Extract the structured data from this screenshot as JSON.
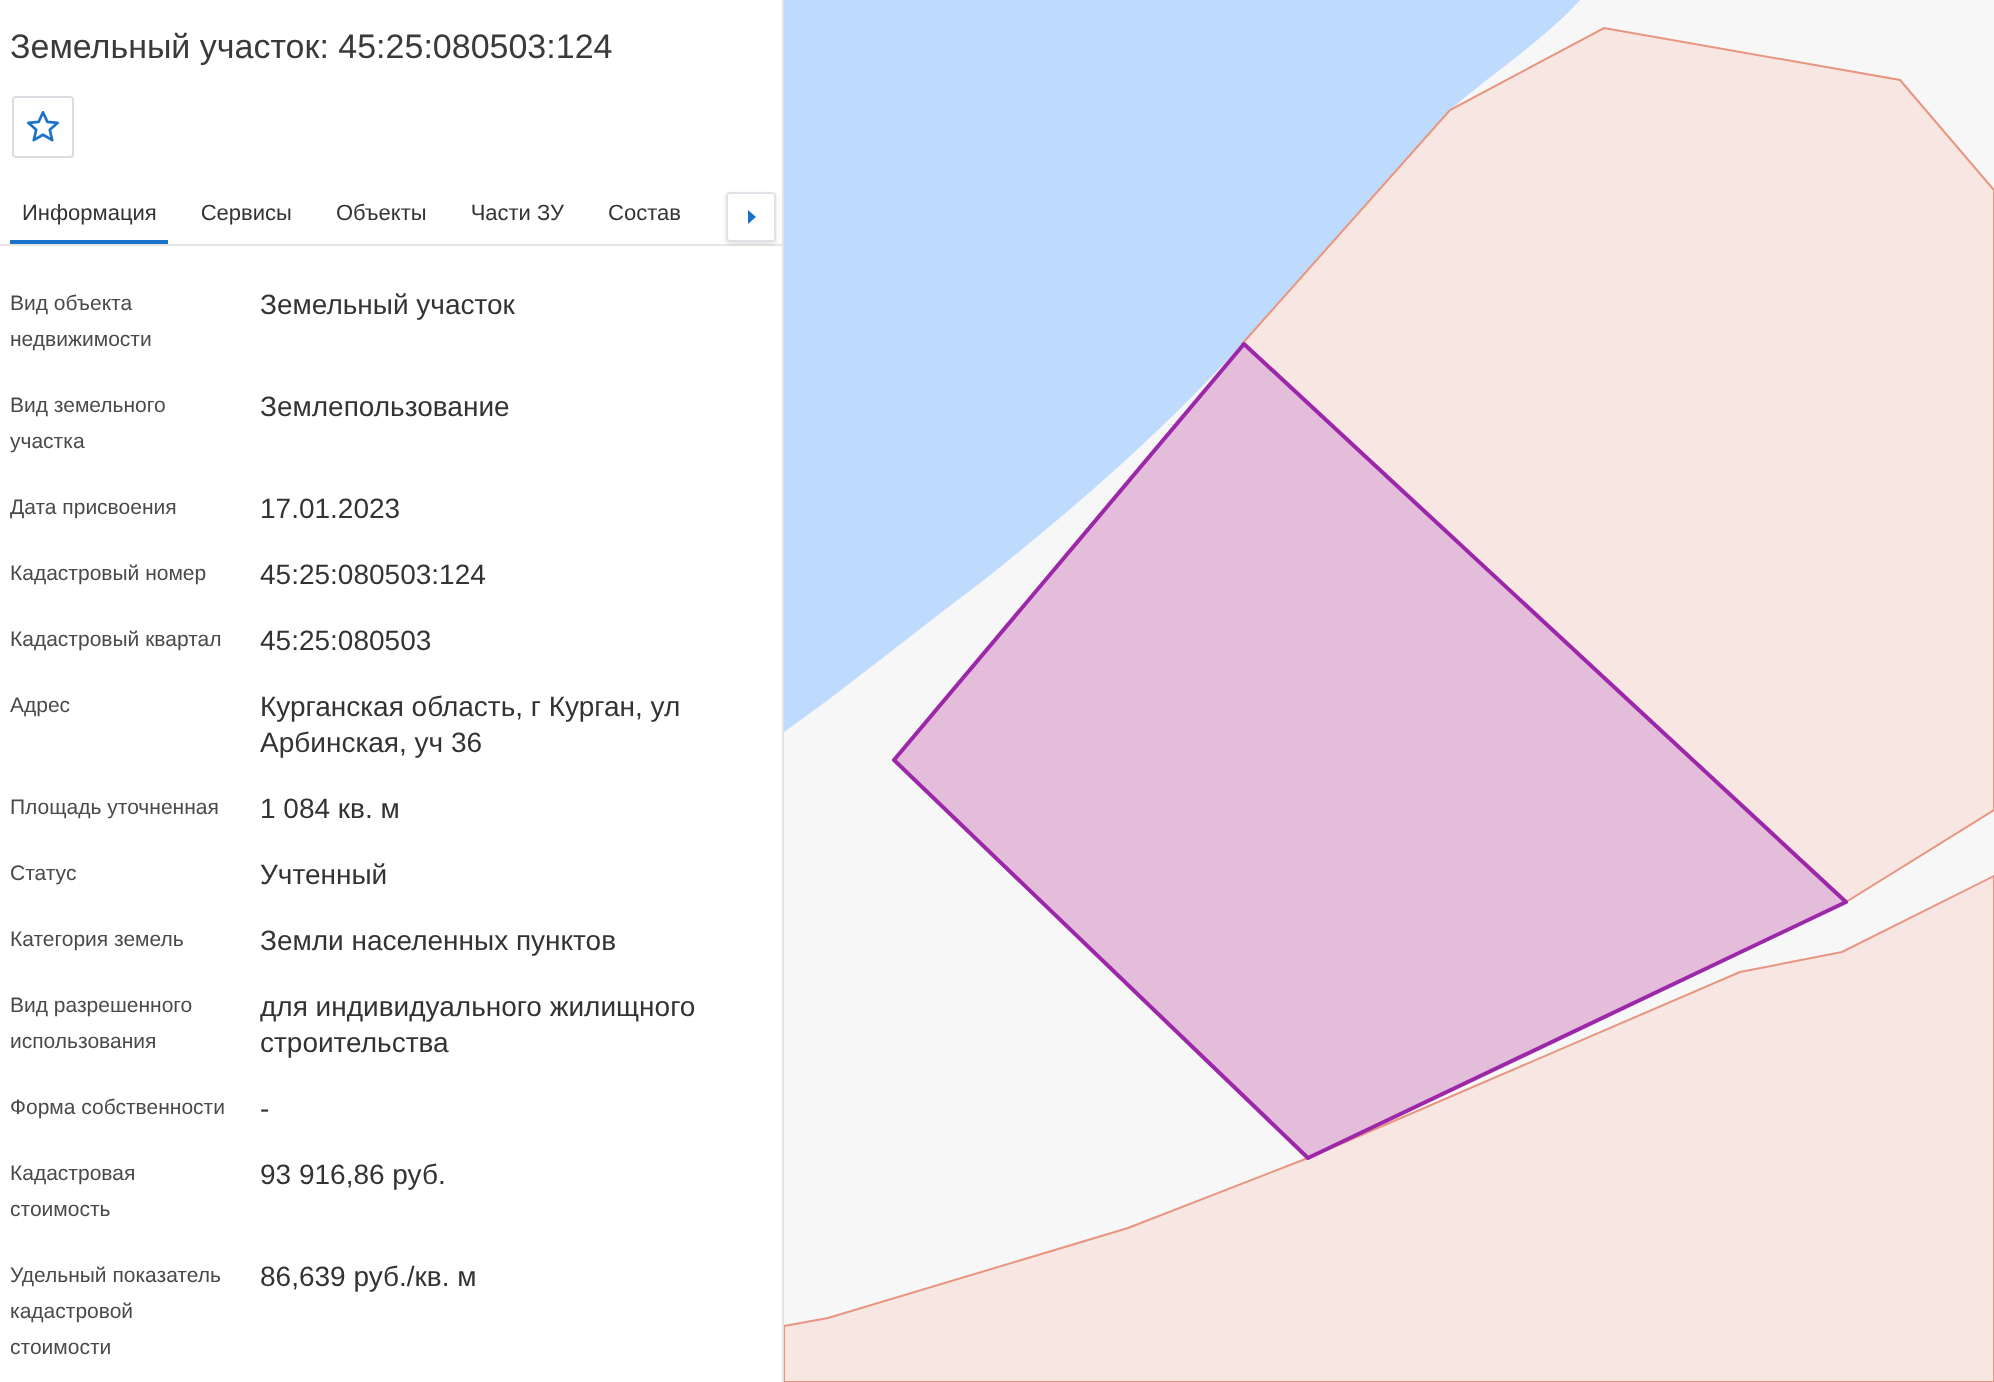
{
  "title": "Земельный участок: 45:25:080503:124",
  "favorite": {
    "starred": false
  },
  "tabs": [
    {
      "label": "Информация",
      "selected": true
    },
    {
      "label": "Сервисы",
      "selected": false
    },
    {
      "label": "Объекты",
      "selected": false
    },
    {
      "label": "Части ЗУ",
      "selected": false
    },
    {
      "label": "Состав",
      "selected": false
    }
  ],
  "properties": [
    {
      "label": "Вид объекта недвижимости",
      "value": "Земельный участок"
    },
    {
      "label": "Вид земельного участка",
      "value": "Землепользование"
    },
    {
      "label": "Дата присвоения",
      "value": "17.01.2023"
    },
    {
      "label": "Кадастровый номер",
      "value": "45:25:080503:124"
    },
    {
      "label": "Кадастровый квартал",
      "value": "45:25:080503"
    },
    {
      "label": "Адрес",
      "value": "Курганская область, г Курган, ул Арбинская, уч 36"
    },
    {
      "label": "Площадь уточненная",
      "value": "1 084 кв. м"
    },
    {
      "label": "Статус",
      "value": "Учтенный"
    },
    {
      "label": "Категория земель",
      "value": "Земли населенных пунктов"
    },
    {
      "label": "Вид разрешенного использования",
      "value": "для индивидуального жилищного строительства"
    },
    {
      "label": "Форма собственности",
      "value": "-"
    },
    {
      "label": "Кадастровая стоимость",
      "value": "93 916,86 руб."
    },
    {
      "label": "Удельный показатель кадастровой стоимости",
      "value": "86,639 руб./кв. м"
    }
  ]
}
